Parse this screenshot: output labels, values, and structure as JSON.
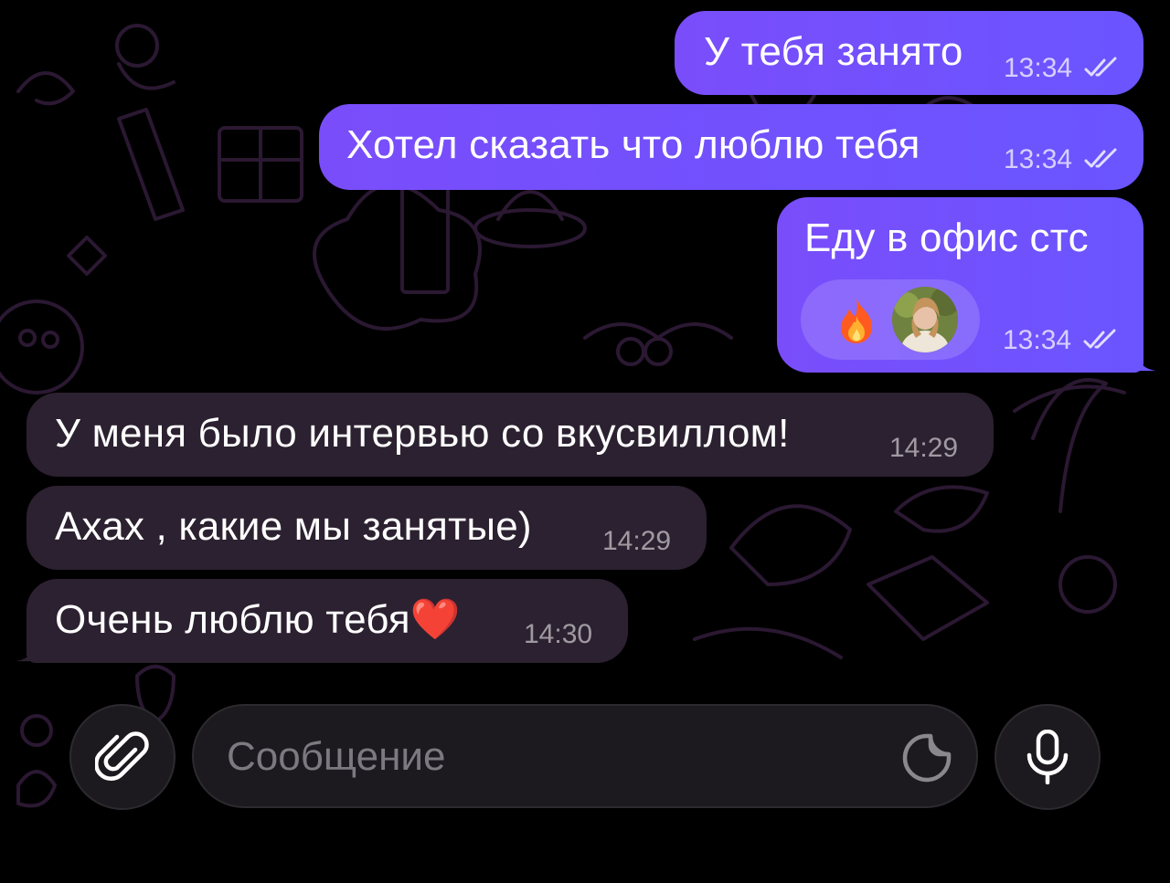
{
  "messages": {
    "out": [
      {
        "text": "У тебя занято",
        "time": "13:34"
      },
      {
        "text": "Хотел сказать что люблю тебя",
        "time": "13:34"
      },
      {
        "text": "Еду в офис стс",
        "time": "13:34",
        "reaction": {
          "emoji": "fire-emoji",
          "reactor": "avatar"
        }
      }
    ],
    "in": [
      {
        "text": "У меня было интервью со вкусвиллом!",
        "time": "14:29"
      },
      {
        "text": "Ахах , какие мы занятые)",
        "time": "14:29"
      },
      {
        "text": "Очень люблю тебя❤️",
        "time": "14:30"
      }
    ]
  },
  "composer": {
    "placeholder": "Сообщение",
    "attach_icon": "paperclip-icon",
    "sticker_icon": "sticker-icon",
    "mic_icon": "microphone-icon"
  },
  "colors": {
    "outgoing_bubble": "#7050fc",
    "incoming_bubble": "#2c2130",
    "background": "#000000",
    "doodle": "#2a1830"
  }
}
